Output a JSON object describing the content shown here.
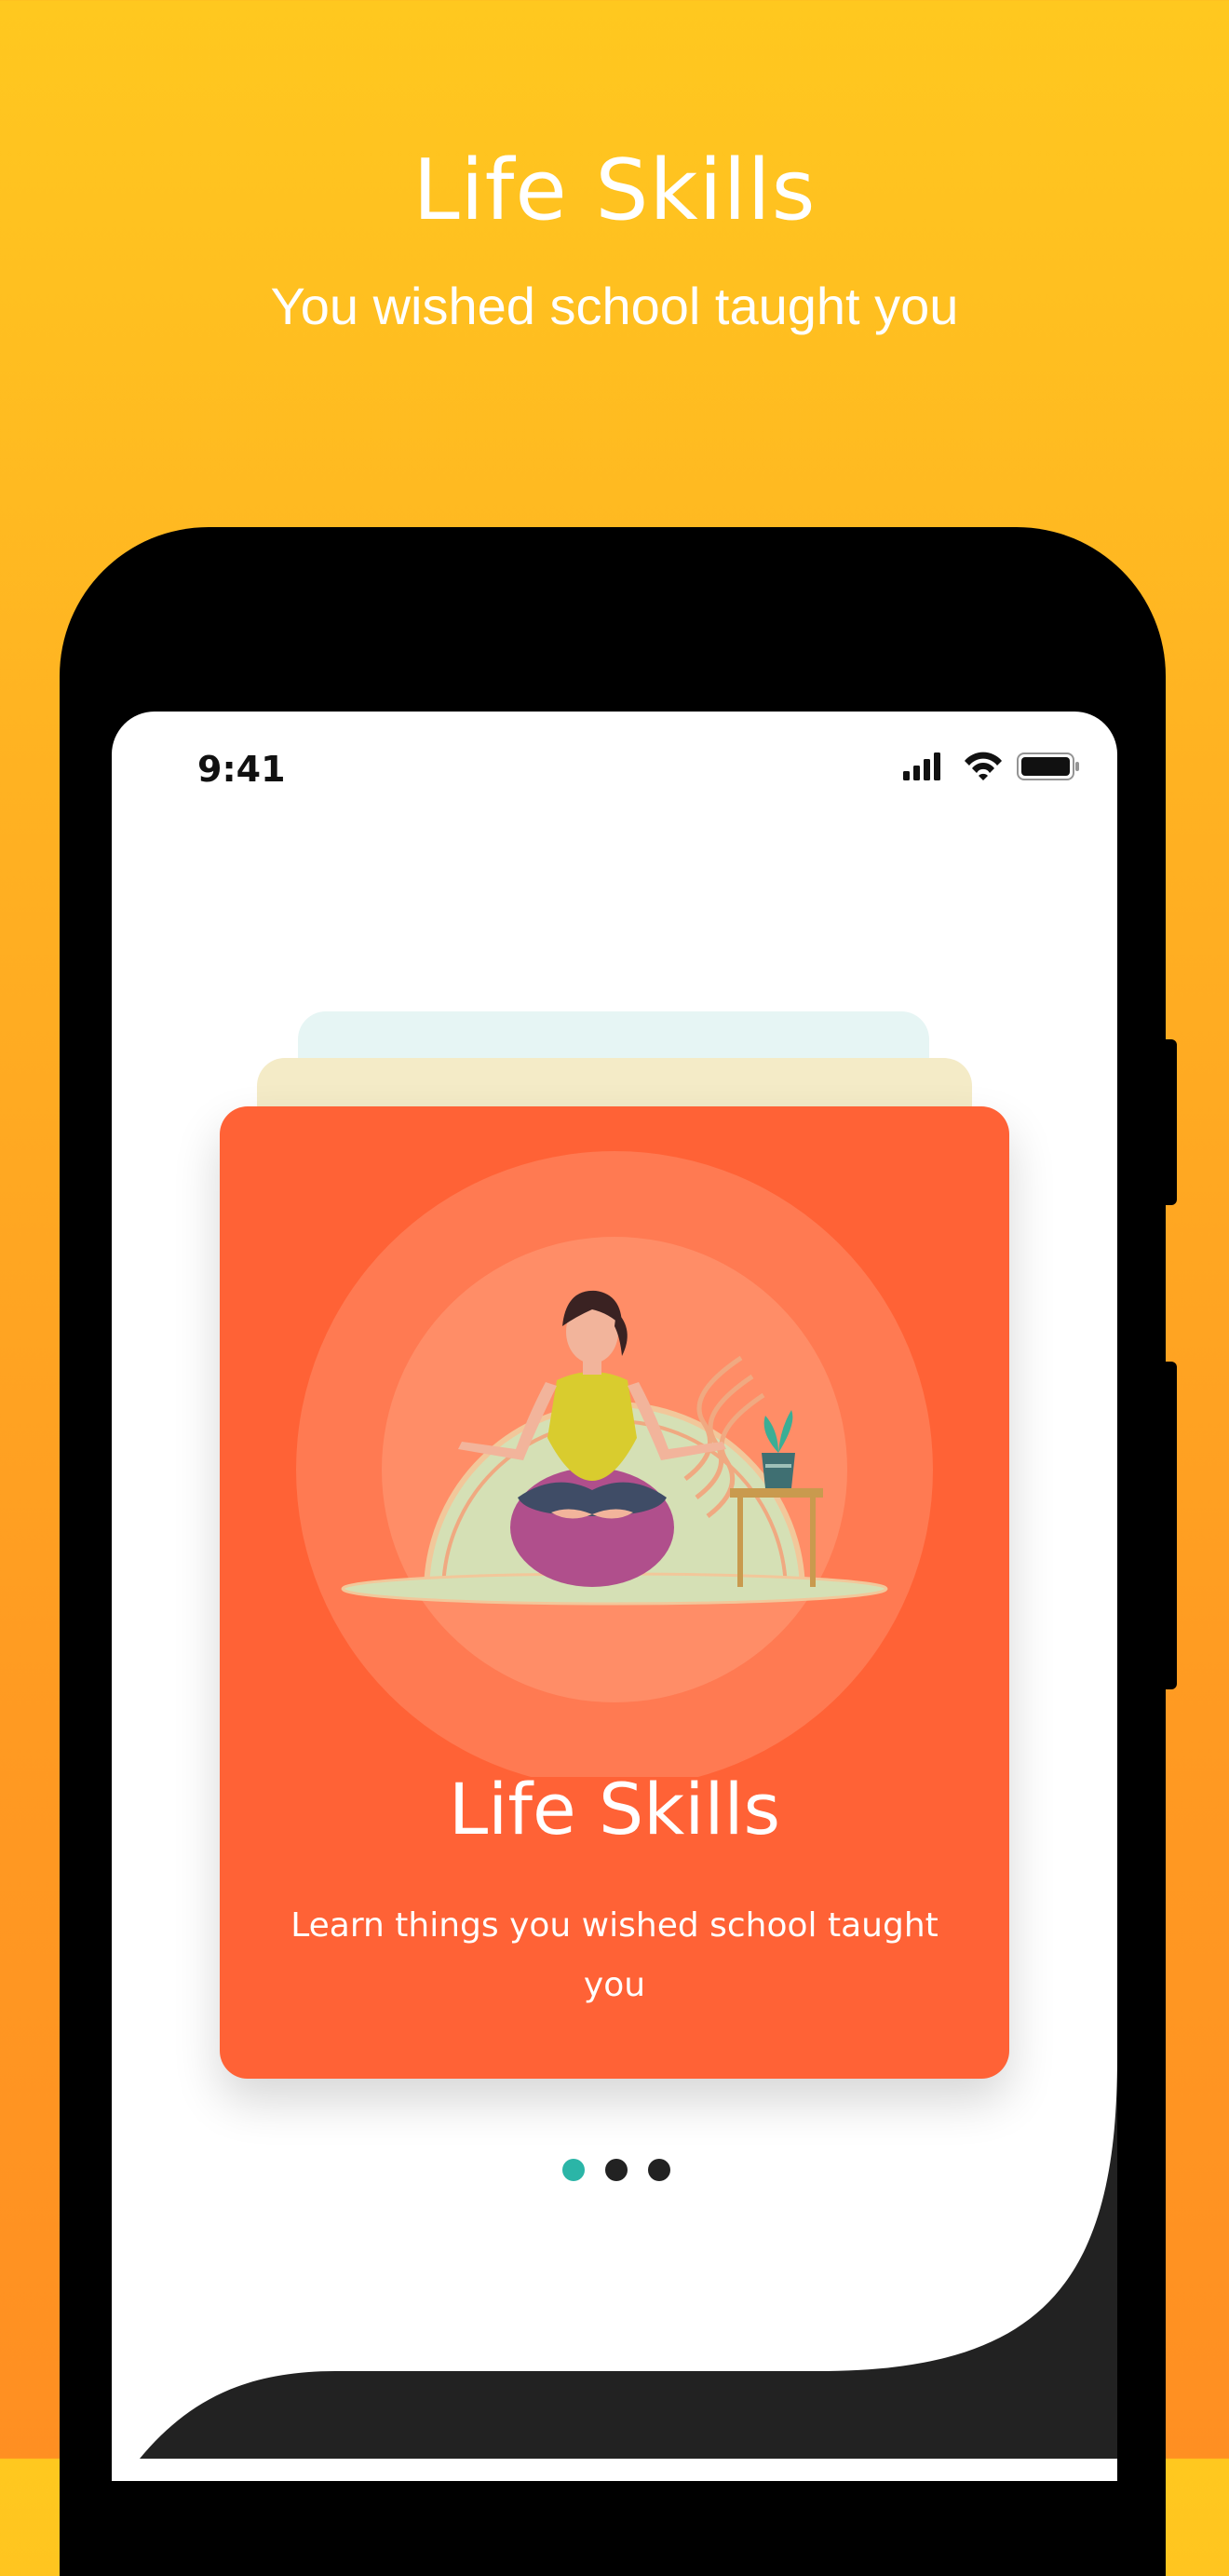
{
  "promo": {
    "title": "Life Skills",
    "subtitle": "You wished school taught you"
  },
  "status_bar": {
    "time": "9:41",
    "icons": [
      "cellular-signal-icon",
      "wifi-icon",
      "battery-icon"
    ]
  },
  "onboarding": {
    "card": {
      "title": "Life Skills",
      "description": "Learn things you wished school taught you",
      "illustration": "meditation-illustration"
    },
    "pagination": {
      "total": 3,
      "active_index": 0
    }
  },
  "colors": {
    "background_top": "#FFC81F",
    "background_bottom": "#FF8F22",
    "card": "#FF6236",
    "active_dot": "#2BB5A7",
    "inactive_dot": "#222222",
    "phone_frame": "#000000",
    "wave": "#222222"
  }
}
